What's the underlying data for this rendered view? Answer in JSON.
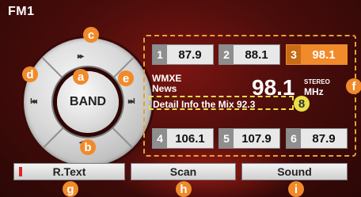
{
  "header": {
    "mode": "FM1"
  },
  "dial": {
    "center_label": "BAND",
    "up_symbol": "▸▸",
    "down_symbol": "◂◂",
    "left_symbol": "I◂◂",
    "right_symbol": "▸▸I"
  },
  "presets": [
    {
      "number": "1",
      "freq": "87.9",
      "active": false
    },
    {
      "number": "2",
      "freq": "88.1",
      "active": false
    },
    {
      "number": "3",
      "freq": "98.1",
      "active": true
    },
    {
      "number": "4",
      "freq": "106.1",
      "active": false
    },
    {
      "number": "5",
      "freq": "107.9",
      "active": false
    },
    {
      "number": "6",
      "freq": "87.9",
      "active": false
    }
  ],
  "station": {
    "call_sign": "WMXE",
    "genre": "News",
    "frequency": "98.1",
    "stereo_label": "STEREO",
    "unit": "MHz",
    "rds_text": "Detail Info the Mix 92.3"
  },
  "buttons": {
    "rtext_label": "R.Text",
    "scan_label": "Scan",
    "sound_label": "Sound"
  },
  "callouts": {
    "a": "a",
    "b": "b",
    "c": "c",
    "d": "d",
    "e": "e",
    "f": "f",
    "g": "g",
    "h": "h",
    "i": "i",
    "rds_marker": "8"
  },
  "colors": {
    "accent": "#f08a2a",
    "rds_marker": "#e8e04a",
    "background": "#4a0d0b"
  }
}
